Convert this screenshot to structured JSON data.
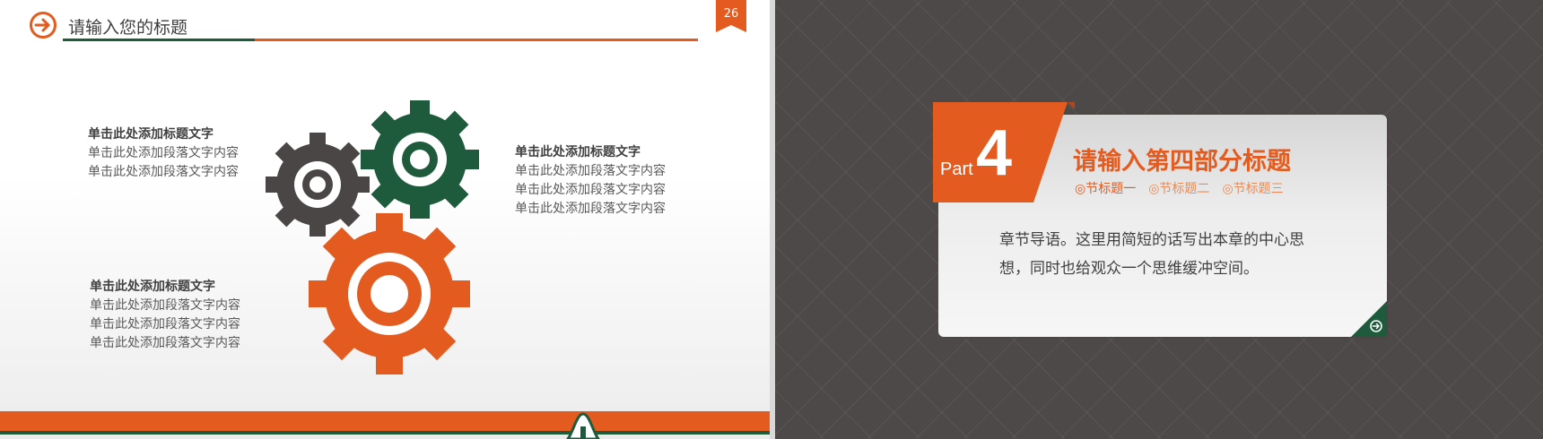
{
  "left_slide": {
    "title": "请输入您的标题",
    "page_number": "26",
    "blocks": [
      {
        "heading": "单击此处添加标题文字",
        "lines": [
          "单击此处添加段落文字内容",
          "单击此处添加段落文字内容"
        ]
      },
      {
        "heading": "单击此处添加标题文字",
        "lines": [
          "单击此处添加段落文字内容",
          "单击此处添加段落文字内容",
          "单击此处添加段落文字内容"
        ]
      },
      {
        "heading": "单击此处添加标题文字",
        "lines": [
          "单击此处添加段落文字内容",
          "单击此处添加段落文字内容",
          "单击此处添加段落文字内容"
        ]
      }
    ]
  },
  "right_slide": {
    "part_label": "Part",
    "part_number": "4",
    "section_title": "请输入第四部分标题",
    "subtitles": [
      "◎节标题一",
      "◎节标题二",
      "◎节标题三"
    ],
    "body": "章节导语。这里用简短的话写出本章的中心思想，同时也给观众一个思维缓冲空间。"
  },
  "colors": {
    "orange": "#e35b1e",
    "green": "#1e5b3c",
    "dark_gray": "#4a4646",
    "bg_dark": "#4d4948"
  },
  "icons": {
    "title_icon": "arrow-right-circle-icon",
    "gears": "gears-icon",
    "corner": "arrow-right-circle-icon"
  }
}
